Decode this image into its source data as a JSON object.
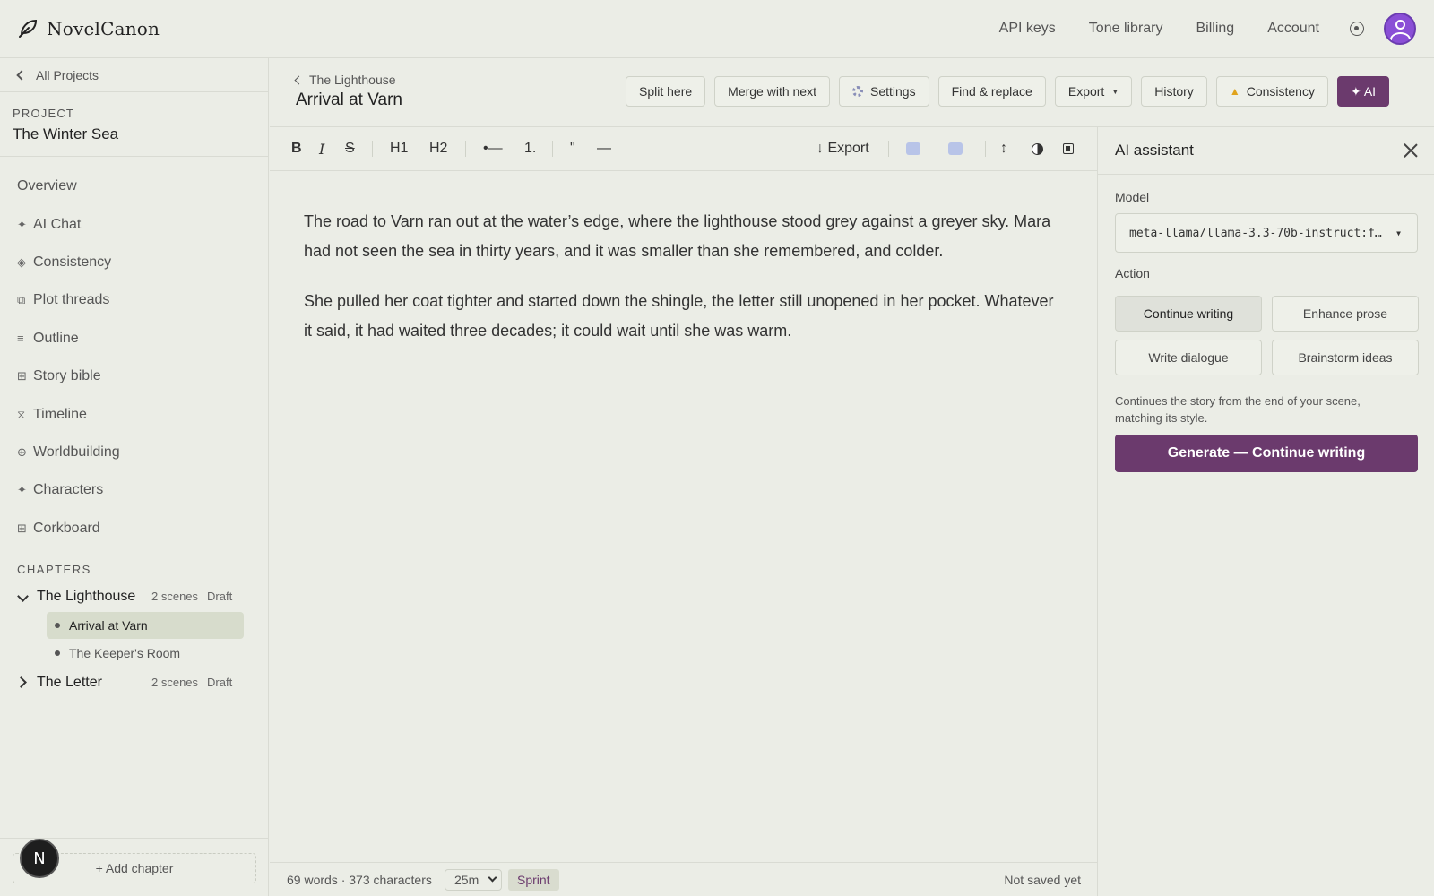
{
  "app": {
    "name": "NovelCanon"
  },
  "topnav": {
    "items": [
      "API keys",
      "Tone library",
      "Billing",
      "Account"
    ]
  },
  "sidebar": {
    "all_projects": "All Projects",
    "project_label": "PROJECT",
    "project_name": "The Winter Sea",
    "nav": [
      {
        "icon": "",
        "label": "Overview"
      },
      {
        "icon": "✦",
        "label": "AI Chat"
      },
      {
        "icon": "◈",
        "label": "Consistency"
      },
      {
        "icon": "⧉",
        "label": "Plot threads"
      },
      {
        "icon": "≡",
        "label": "Outline"
      },
      {
        "icon": "⊞",
        "label": "Story bible"
      },
      {
        "icon": "⧖",
        "label": "Timeline"
      },
      {
        "icon": "⊕",
        "label": "Worldbuilding"
      },
      {
        "icon": "✦",
        "label": "Characters"
      },
      {
        "icon": "⊞",
        "label": "Corkboard"
      }
    ],
    "chapters_label": "CHAPTERS",
    "chapters": [
      {
        "name": "The Lighthouse",
        "meta": "2 scenes",
        "status": "Draft",
        "expanded": true,
        "scenes": [
          {
            "name": "Arrival at Varn",
            "active": true
          },
          {
            "name": "The Keeper's Room",
            "active": false
          }
        ]
      },
      {
        "name": "The Letter",
        "meta": "2 scenes",
        "status": "Draft",
        "expanded": false,
        "scenes": []
      }
    ],
    "add_chapter": "+ Add chapter",
    "badge_letter": "N"
  },
  "header": {
    "crumb": "The Lighthouse",
    "title": "Arrival at Varn",
    "buttons": {
      "split": "Split here",
      "merge": "Merge with next",
      "settings": "Settings",
      "find": "Find & replace",
      "export": "Export",
      "history": "History",
      "consistency": "Consistency",
      "ai": "✦ AI"
    }
  },
  "toolbar": {
    "bold": "B",
    "italic": "I",
    "strike": "S",
    "h1": "H1",
    "h2": "H2",
    "bullet": "•—",
    "numbered": "1.",
    "quote": "\"",
    "rule": "—",
    "export": "↓ Export",
    "line_height": "↕"
  },
  "editor": {
    "paragraphs": [
      "The road to Varn ran out at the water’s edge, where the lighthouse stood grey against a greyer sky. Mara had not seen the sea in thirty years, and it was smaller than she remembered, and colder.",
      "She pulled her coat tighter and started down the shingle, the letter still unopened in her pocket. Whatever it said, it had waited three decades; it could wait until she was warm."
    ]
  },
  "status": {
    "words": "69 words · 373 characters",
    "timer": "25m",
    "sprint": "Sprint",
    "saved": "Not saved yet"
  },
  "ai_panel": {
    "title": "AI assistant",
    "model_label": "Model",
    "model_value": "meta-llama/llama-3.3-70b-instruct:f…",
    "action_label": "Action",
    "actions": [
      "Continue writing",
      "Enhance prose",
      "Write dialogue",
      "Brainstorm ideas"
    ],
    "selected_action": "Continue writing",
    "description": "Continues the story from the end of your scene, matching its style.",
    "generate": "Generate — Continue writing"
  },
  "colors": {
    "background": "#ebede6",
    "accent": "#6b3a6d",
    "avatar": "#8a4fd6"
  }
}
